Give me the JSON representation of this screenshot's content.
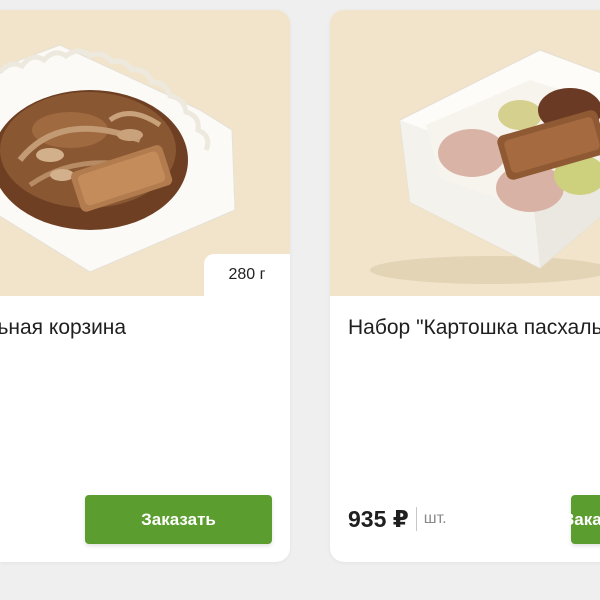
{
  "products": [
    {
      "title": "Пасхальная корзина",
      "weight": "280 г",
      "order_label": "Заказать",
      "image_icon": "chocolate-easter-basket-in-box"
    },
    {
      "title": "Набор \"Картошка пасхальная\"",
      "price": "935 ₽",
      "unit": "шт.",
      "order_label": "Заказать",
      "image_icon": "easter-potato-cake-set-in-box"
    }
  ],
  "colors": {
    "page_bg": "#efefef",
    "card_bg": "#ffffff",
    "image_bg": "#f1e4cb",
    "order_button": "#5c9d2f"
  }
}
